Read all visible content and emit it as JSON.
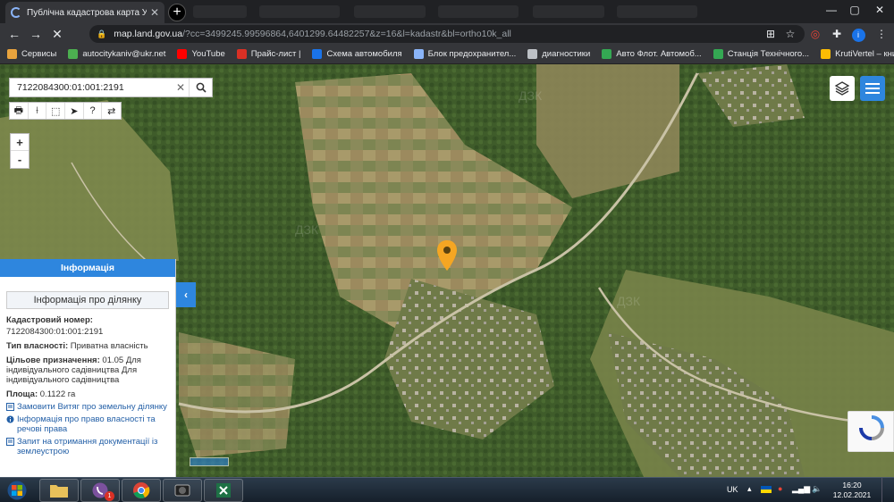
{
  "browser": {
    "tab_title": "Публічна кадастрова карта Україн",
    "url_host": "map.land.gov.ua",
    "url_path": "/?cc=3499245.99596864,6401299.64482257&z=16&l=kadastr&bl=ortho10k_all",
    "profile_initial": "i"
  },
  "bookmarks": [
    {
      "label": "Сервисы",
      "color": "#e8a33d"
    },
    {
      "label": "autocitykaniv@ukr.net",
      "color": "#4caf50"
    },
    {
      "label": "YouTube",
      "color": "#ff0000"
    },
    {
      "label": "Прайс-лист |",
      "color": "#d93025"
    },
    {
      "label": "Схема автомобиля",
      "color": "#1a73e8"
    },
    {
      "label": "Блок предохранител...",
      "color": "#8ab4f8"
    },
    {
      "label": "диагностики",
      "color": "#bdc1c6"
    },
    {
      "label": "Авто Флот. Автомоб...",
      "color": "#34a853"
    },
    {
      "label": "Станція Технічного...",
      "color": "#34a853"
    },
    {
      "label": "KrutiVertel – книги п...",
      "color": "#fbbc04"
    }
  ],
  "map": {
    "search_value": "7122084300:01:001:2191",
    "zoom_in": "+",
    "zoom_out": "-"
  },
  "info_panel": {
    "header": "Інформація",
    "subheader": "Інформація про ділянку",
    "cadastral_label": "Кадастровий номер:",
    "cadastral_value": "7122084300:01:001:2191",
    "ownership_label": "Тип власності:",
    "ownership_value": "Приватна власність",
    "purpose_label": "Цільове призначення:",
    "purpose_value": "01.05 Для індивідуального садівництва Для індивідуального садівництва",
    "area_label": "Площа:",
    "area_value": "0.1122 га",
    "links": [
      "Замовити Витяг про земельну ділянку",
      "Інформація про право власності та речові права",
      "Запит на отримання документації із землеустрою"
    ]
  },
  "taskbar": {
    "lang": "UK",
    "time": "16:20",
    "date": "12.02.2021",
    "viber_badge": "1"
  }
}
